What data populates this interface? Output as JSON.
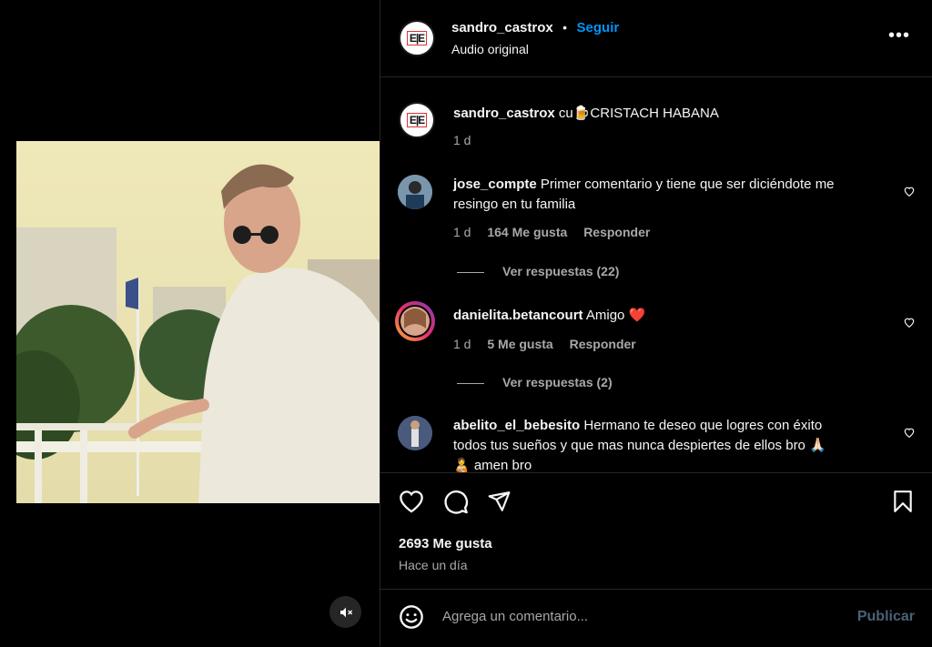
{
  "header": {
    "username": "sandro_castrox",
    "separator": "•",
    "follow_label": "Seguir",
    "subtitle": "Audio original",
    "avatar_text": "E|E",
    "more_icon": "more-horizontal-icon"
  },
  "caption": {
    "username": "sandro_castrox",
    "text": "cu🍺CRISTACH HABANA",
    "time": "1 d"
  },
  "comments": [
    {
      "username": "jose_compte",
      "text": "Primer comentario y tiene que ser diciéndote me",
      "text2": "resingo en tu familia",
      "time": "1 d",
      "likes": "164 Me gusta",
      "reply": "Responder",
      "view_replies": "Ver respuestas (22)"
    },
    {
      "username": "danielita.betancourt",
      "text": "Amigo ❤️",
      "time": "1 d",
      "likes": "5 Me gusta",
      "reply": "Responder",
      "view_replies": "Ver respuestas (2)"
    },
    {
      "username": "abelito_el_bebesito",
      "text": "Hermano te deseo que logres con éxito",
      "text2": "todos tus sueños y que mas nunca despiertes de ellos bro 🙏🏻",
      "text3": "🧑‍🍼 amen bro"
    }
  ],
  "actions": {
    "likes": "2693 Me gusta",
    "time": "Hace un día"
  },
  "composer": {
    "placeholder": "Agrega un comentario...",
    "publish": "Publicar"
  },
  "colors": {
    "accent": "#0095f6",
    "muted": "#a8a8a8",
    "publish_disabled": "#4a6275"
  }
}
